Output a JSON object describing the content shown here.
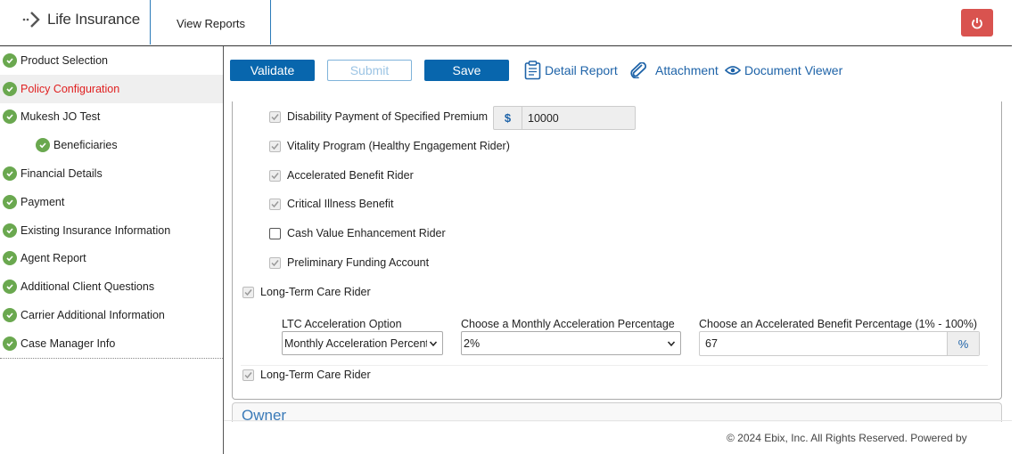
{
  "header": {
    "app_title": "Life Insurance",
    "view_reports": "View Reports"
  },
  "sidebar": {
    "items": [
      {
        "label": "Product Selection"
      },
      {
        "label": "Policy Configuration"
      },
      {
        "label": "Mukesh JO Test"
      },
      {
        "label": "Beneficiaries"
      },
      {
        "label": "Financial Details"
      },
      {
        "label": "Payment"
      },
      {
        "label": "Existing Insurance Information"
      },
      {
        "label": "Agent Report"
      },
      {
        "label": "Additional Client Questions"
      },
      {
        "label": "Carrier Additional Information"
      },
      {
        "label": "Case Manager Info"
      }
    ]
  },
  "toolbar": {
    "validate": "Validate",
    "submit": "Submit",
    "save": "Save",
    "detail_report": "Detail Report",
    "attachment": "Attachment",
    "document_viewer": "Document Viewer"
  },
  "riders": {
    "disability": {
      "label": "Disability Payment of Specified Premium",
      "currency": "$",
      "value": "10000"
    },
    "vitality": {
      "label": "Vitality Program (Healthy Engagement Rider)"
    },
    "accelerated": {
      "label": "Accelerated Benefit Rider"
    },
    "critical": {
      "label": "Critical Illness Benefit"
    },
    "cash_value": {
      "label": "Cash Value Enhancement Rider"
    },
    "preliminary": {
      "label": "Preliminary Funding Account"
    },
    "ltc1": {
      "label": "Long-Term Care Rider"
    },
    "ltc2": {
      "label": "Long-Term Care Rider"
    }
  },
  "ltc": {
    "option_label": "LTC Acceleration Option",
    "option_value": "Monthly Acceleration Percentage",
    "monthly_label": "Choose a Monthly Acceleration Percentage",
    "monthly_value": "2%",
    "benefit_label": "Choose an Accelerated Benefit Percentage (1% - 100%)",
    "benefit_value": "67",
    "benefit_unit": "%"
  },
  "owner": {
    "title": "Owner"
  },
  "footer": {
    "text": "© 2024 Ebix, Inc. All Rights Reserved. Powered by"
  }
}
